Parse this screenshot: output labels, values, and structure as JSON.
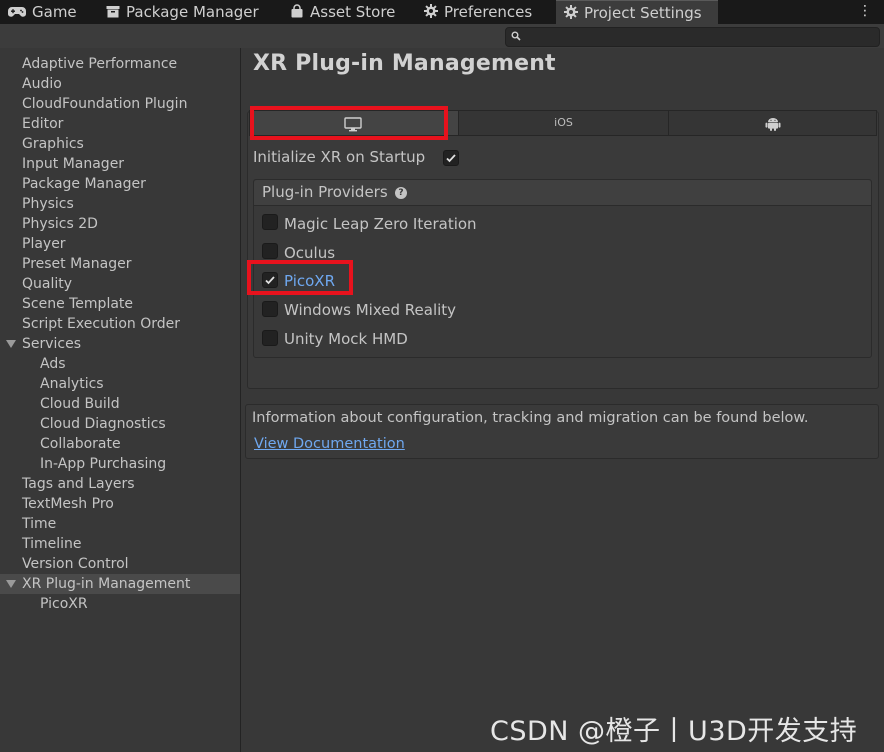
{
  "tabs": [
    {
      "label": "Game",
      "icon": "gamepad-icon"
    },
    {
      "label": "Package Manager",
      "icon": "package-icon"
    },
    {
      "label": "Asset Store",
      "icon": "shopping-bag-icon"
    },
    {
      "label": "Preferences",
      "icon": "gear-icon"
    },
    {
      "label": "Project Settings",
      "icon": "gear-icon",
      "active": true
    }
  ],
  "search": {
    "placeholder": ""
  },
  "sidebar": {
    "items": [
      {
        "label": "Adaptive Performance"
      },
      {
        "label": "Audio"
      },
      {
        "label": "CloudFoundation Plugin"
      },
      {
        "label": "Editor"
      },
      {
        "label": "Graphics"
      },
      {
        "label": "Input Manager"
      },
      {
        "label": "Package Manager"
      },
      {
        "label": "Physics"
      },
      {
        "label": "Physics 2D"
      },
      {
        "label": "Player"
      },
      {
        "label": "Preset Manager"
      },
      {
        "label": "Quality"
      },
      {
        "label": "Scene Template"
      },
      {
        "label": "Script Execution Order"
      },
      {
        "label": "Services",
        "expanded": true
      },
      {
        "label": "Ads"
      },
      {
        "label": "Analytics"
      },
      {
        "label": "Cloud Build"
      },
      {
        "label": "Cloud Diagnostics"
      },
      {
        "label": "Collaborate"
      },
      {
        "label": "In-App Purchasing"
      },
      {
        "label": "Tags and Layers"
      },
      {
        "label": "TextMesh Pro"
      },
      {
        "label": "Time"
      },
      {
        "label": "Timeline"
      },
      {
        "label": "Version Control"
      },
      {
        "label": "XR Plug-in Management",
        "expanded": true,
        "selected": true
      },
      {
        "label": "PicoXR"
      }
    ]
  },
  "content": {
    "title": "XR Plug-in Management",
    "platform_tabs": [
      {
        "icon": "monitor-icon",
        "label": "",
        "active": true
      },
      {
        "icon": "",
        "label": "iOS"
      },
      {
        "icon": "android-icon",
        "label": ""
      }
    ],
    "init_label": "Initialize XR on Startup",
    "init_checked": true,
    "providers_title": "Plug-in Providers",
    "providers_help_glyph": "?",
    "providers": [
      {
        "label": "Magic Leap Zero Iteration",
        "checked": false
      },
      {
        "label": "Oculus",
        "checked": false
      },
      {
        "label": "PicoXR",
        "checked": true
      },
      {
        "label": "Windows Mixed Reality",
        "checked": false
      },
      {
        "label": "Unity Mock HMD",
        "checked": false
      }
    ],
    "info_text": "Information about configuration, tracking and migration can be found below.",
    "doc_link": "View Documentation"
  },
  "menu_glyph": "⋮",
  "watermark": "CSDN @橙子丨U3D开发支持",
  "colors": {
    "highlight": "#e8121d",
    "link": "#6fa8f0",
    "background": "#383838"
  }
}
